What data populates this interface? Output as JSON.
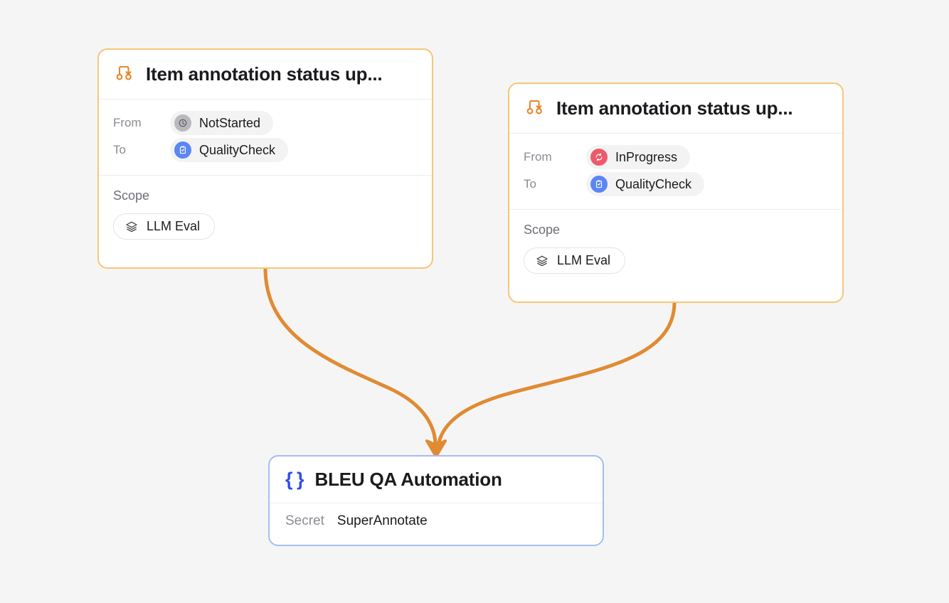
{
  "canvas": {
    "background": "#f5f5f5"
  },
  "colors": {
    "trigger_border": "#f6c679",
    "action_border": "#a7bdf2",
    "edge": "#e08b33",
    "trigger_icon": "#e8862c",
    "brace_blue": "#2f4df0",
    "status_notstarted": "#b8b8bd",
    "status_inprogress": "#ee5a6b",
    "status_qualitycheck": "#5b86f5"
  },
  "nodes": [
    {
      "id": "trigger-1",
      "kind": "trigger",
      "icon": "workflow-branch-icon",
      "title": "Item annotation status up...",
      "transitions": [
        {
          "label": "From",
          "status": "NotStarted",
          "status_icon": "clock-icon",
          "color": "#b8b8bd"
        },
        {
          "label": "To",
          "status": "QualityCheck",
          "status_icon": "clipboard-check-icon",
          "color": "#5b86f5"
        }
      ],
      "scope": {
        "label": "Scope",
        "chip": {
          "icon": "layers-icon",
          "label": "LLM Eval"
        }
      }
    },
    {
      "id": "trigger-2",
      "kind": "trigger",
      "icon": "workflow-branch-icon",
      "title": "Item annotation status up...",
      "transitions": [
        {
          "label": "From",
          "status": "InProgress",
          "status_icon": "refresh-icon",
          "color": "#ee5a6b"
        },
        {
          "label": "To",
          "status": "QualityCheck",
          "status_icon": "clipboard-check-icon",
          "color": "#5b86f5"
        }
      ],
      "scope": {
        "label": "Scope",
        "chip": {
          "icon": "layers-icon",
          "label": "LLM Eval"
        }
      }
    },
    {
      "id": "action-1",
      "kind": "action",
      "icon": "curly-braces-icon",
      "icon_glyph": "{ }",
      "title": "BLEU QA Automation",
      "secret": {
        "label": "Secret",
        "value": "SuperAnnotate"
      }
    }
  ],
  "edges": [
    {
      "from": "trigger-1",
      "to": "action-1"
    },
    {
      "from": "trigger-2",
      "to": "action-1"
    }
  ]
}
